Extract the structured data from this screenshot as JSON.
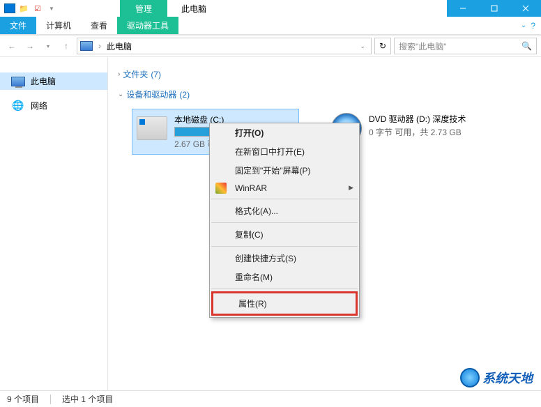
{
  "titlebar": {
    "ribbon_context_tab": "管理",
    "window_title": "此电脑"
  },
  "ribbon": {
    "file": "文件",
    "computer": "计算机",
    "view": "查看",
    "drive_tools": "驱动器工具"
  },
  "nav": {
    "location": "此电脑",
    "search_placeholder": "搜索\"此电脑\""
  },
  "sidebar": {
    "items": [
      {
        "label": "此电脑",
        "selected": true
      },
      {
        "label": "网络",
        "selected": false
      }
    ]
  },
  "groups": {
    "folders": {
      "label": "文件夹",
      "count": "(7)"
    },
    "devices": {
      "label": "设备和驱动器",
      "count": "(2)"
    }
  },
  "drives": [
    {
      "name": "本地磁盘 (C:)",
      "sub": "2.67 GB 可用",
      "fill_percent": 85,
      "selected": true,
      "type": "hdd"
    },
    {
      "name": "DVD 驱动器 (D:) 深度技术",
      "sub": "0 字节 可用，共 2.73 GB",
      "type": "dvd"
    }
  ],
  "context_menu": {
    "open": "打开(O)",
    "open_new_window": "在新窗口中打开(E)",
    "pin_start": "固定到\"开始\"屏幕(P)",
    "winrar": "WinRAR",
    "format": "格式化(A)...",
    "copy": "复制(C)",
    "create_shortcut": "创建快捷方式(S)",
    "rename": "重命名(M)",
    "properties": "属性(R)"
  },
  "statusbar": {
    "items": "9 个项目",
    "selected": "选中 1 个项目"
  },
  "watermark": "系统天地"
}
